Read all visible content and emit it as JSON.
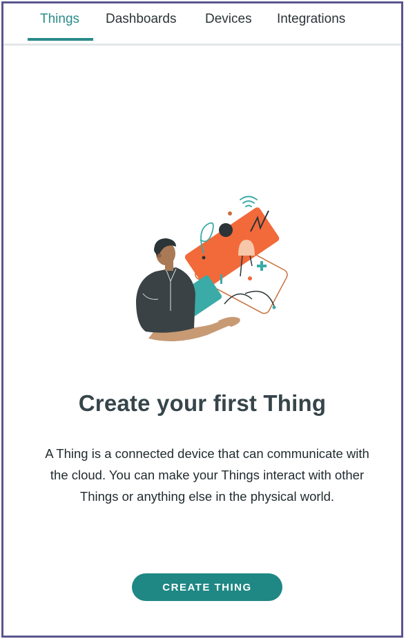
{
  "tabs": [
    {
      "label": "Things",
      "active": true
    },
    {
      "label": "Dashboards",
      "active": false
    },
    {
      "label": "Devices",
      "active": false
    },
    {
      "label": "Integrations",
      "active": false
    }
  ],
  "empty_state": {
    "illustration_icon": "person-holding-device-illustration",
    "title": "Create your first Thing",
    "description": "A Thing is a connected device that can communicate with the cloud. You can make your Things interact with other Things or anything else in the physical world.",
    "cta_label": "CREATE THING"
  },
  "colors": {
    "accent": "#2a8c8a",
    "button": "#1f8784",
    "title_text": "#36454a",
    "frame_border": "#5a5490",
    "illustration_orange": "#f2693a",
    "illustration_teal": "#3aaba6"
  }
}
